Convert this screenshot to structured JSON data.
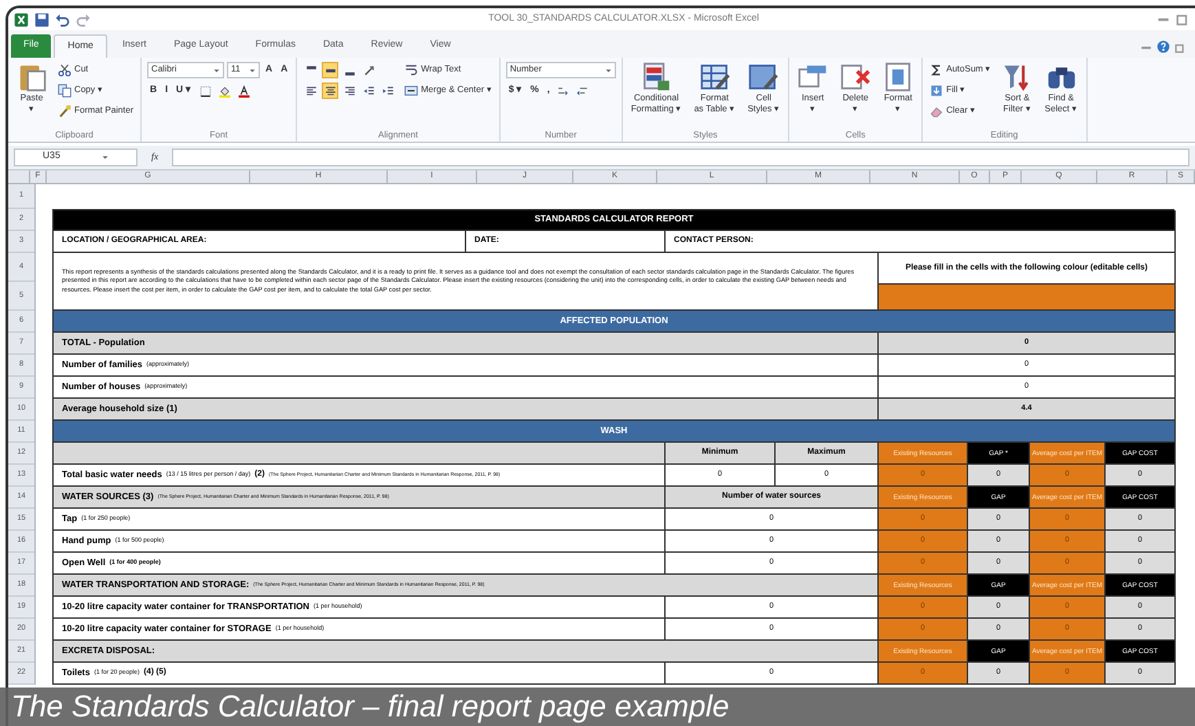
{
  "window": {
    "title": "TOOL 30_STANDARDS CALCULATOR.XLSX - Microsoft Excel"
  },
  "ribbon_tabs": [
    {
      "label": "File",
      "kind": "file",
      "selected": false
    },
    {
      "label": "Home",
      "kind": "tab",
      "selected": true
    },
    {
      "label": "Insert",
      "kind": "tab",
      "selected": false
    },
    {
      "label": "Page Layout",
      "kind": "tab",
      "selected": false
    },
    {
      "label": "Formulas",
      "kind": "tab",
      "selected": false
    },
    {
      "label": "Data",
      "kind": "tab",
      "selected": false
    },
    {
      "label": "Review",
      "kind": "tab",
      "selected": false
    },
    {
      "label": "View",
      "kind": "tab",
      "selected": false
    }
  ],
  "ribbon_groups": [
    {
      "name": "Clipboard",
      "columns": [
        [
          [
            {
              "kind": "large",
              "label": "Paste\n▾"
            }
          ]
        ],
        [
          [
            {
              "kind": "small",
              "label": "Cut"
            }
          ],
          [
            {
              "kind": "small",
              "label": "Copy ▾"
            }
          ],
          [
            {
              "kind": "small",
              "label": "Format Painter"
            }
          ]
        ]
      ]
    },
    {
      "name": "Font",
      "columns": [
        [
          [
            {
              "kind": "combo",
              "label": "Calibri"
            },
            {
              "kind": "combo",
              "label": "11"
            },
            {
              "kind": "glyph",
              "label": "A"
            },
            {
              "kind": "glyph",
              "label": "A"
            }
          ],
          [
            {
              "kind": "glyph",
              "label": "B"
            },
            {
              "kind": "glyph",
              "label": "I"
            },
            {
              "kind": "glyph",
              "label": "U ▾"
            },
            {
              "kind": "icon"
            },
            {
              "kind": "icon"
            },
            {
              "kind": "icon"
            }
          ]
        ]
      ]
    },
    {
      "name": "Alignment",
      "columns": [
        [
          [
            {
              "kind": "icon",
              "selected": false
            },
            {
              "kind": "icon",
              "selected": true
            },
            {
              "kind": "icon",
              "selected": false
            },
            {
              "kind": "icon",
              "selected": false
            }
          ],
          [
            {
              "kind": "icon",
              "selected": false
            },
            {
              "kind": "icon",
              "selected": true
            },
            {
              "kind": "icon",
              "selected": false
            },
            {
              "kind": "icon",
              "selected": false
            },
            {
              "kind": "icon",
              "selected": false
            }
          ]
        ],
        [
          [
            {
              "kind": "small",
              "label": "Wrap Text"
            }
          ],
          [
            {
              "kind": "small",
              "label": "Merge & Center ▾"
            }
          ]
        ]
      ]
    },
    {
      "name": "Number",
      "columns": [
        [
          [
            {
              "kind": "combo",
              "label": "Number"
            }
          ],
          [
            {
              "kind": "glyph",
              "label": "$ ▾"
            },
            {
              "kind": "glyph",
              "label": "%"
            },
            {
              "kind": "glyph",
              "label": ","
            },
            {
              "kind": "icon"
            },
            {
              "kind": "icon"
            }
          ]
        ]
      ]
    },
    {
      "name": "Styles",
      "columns": [
        [
          [
            {
              "kind": "large",
              "label": "Conditional\nFormatting ▾"
            }
          ]
        ],
        [
          [
            {
              "kind": "large",
              "label": "Format\nas Table ▾"
            }
          ]
        ],
        [
          [
            {
              "kind": "large",
              "label": "Cell\nStyles ▾"
            }
          ]
        ]
      ]
    },
    {
      "name": "Cells",
      "columns": [
        [
          [
            {
              "kind": "large",
              "label": "Insert\n▾"
            }
          ]
        ],
        [
          [
            {
              "kind": "large",
              "label": "Delete\n▾"
            }
          ]
        ],
        [
          [
            {
              "kind": "large",
              "label": "Format\n▾"
            }
          ]
        ]
      ]
    },
    {
      "name": "Editing",
      "columns": [
        [
          [
            {
              "kind": "small",
              "label": "AutoSum ▾"
            }
          ],
          [
            {
              "kind": "small",
              "label": "Fill ▾"
            }
          ],
          [
            {
              "kind": "small",
              "label": "Clear ▾"
            }
          ]
        ],
        [
          [
            {
              "kind": "large",
              "label": "Sort &\nFilter ▾"
            }
          ]
        ],
        [
          [
            {
              "kind": "large",
              "label": "Find &\nSelect ▾"
            }
          ]
        ]
      ]
    }
  ],
  "formula_bar": {
    "name_box": "U35",
    "function_button": "fx"
  },
  "columns": [
    "F",
    "G",
    "H",
    "I",
    "J",
    "K",
    "L",
    "M",
    "N",
    "O",
    "P",
    "Q",
    "R",
    "S"
  ],
  "sheet_rows": [
    {
      "kind": "blank",
      "nums": [
        "1"
      ]
    },
    {
      "kind": "title",
      "nums": [
        "2"
      ],
      "text": "STANDARDS CALCULATOR REPORT"
    },
    {
      "kind": "fields",
      "nums": [
        "3"
      ],
      "cells": [
        "LOCATION / GEOGRAPHICAL AREA:",
        "DATE:",
        "CONTACT PERSON:"
      ]
    },
    {
      "kind": "notes",
      "nums": [
        "4",
        "5"
      ],
      "text": "This report represents a synthesis of the standards calculations presented along the Standards Calculator, and it is a ready to print file. It serves as a guidance tool and does not exempt the consultation of each sector standards calculation page in the Standards Calculator. The figures presented in this report are according to the calculations that have to be completed within each sector page of the Standards Calculator. Please insert the existing resources (considering the unit) into the corresponding cells, in order to calculate the existing GAP between needs and resources. Please insert the cost per item, in order to calculate the GAP cost per item, and to calculate the total GAP cost per sector.",
      "legend": "Please fill in the cells with the following colour (editable cells)"
    },
    {
      "kind": "section",
      "nums": [
        "6"
      ],
      "text": "AFFECTED POPULATION"
    },
    {
      "kind": "total",
      "nums": [
        "7"
      ],
      "label": "TOTAL - Population",
      "value": "0",
      "shaded": true
    },
    {
      "kind": "total",
      "nums": [
        "8"
      ],
      "label": "Number of families",
      "note": "(approximately)",
      "value": "0",
      "shaded": false
    },
    {
      "kind": "total",
      "nums": [
        "9"
      ],
      "label": "Number of houses",
      "note": "(approximately)",
      "value": "0",
      "shaded": false
    },
    {
      "kind": "total",
      "nums": [
        "10"
      ],
      "label": "Average household size (1)",
      "value": "4.4",
      "shaded": true
    },
    {
      "kind": "section",
      "nums": [
        "11"
      ],
      "text": "WASH"
    },
    {
      "kind": "heading",
      "nums": [
        "12"
      ],
      "min": "Minimum",
      "max": "Maximum",
      "headers": [
        {
          "text": "Existing Resources",
          "kind": "input"
        },
        {
          "text": "GAP *",
          "kind": "calc"
        },
        {
          "text": "Average cost per ITEM",
          "kind": "input"
        },
        {
          "text": "GAP COST",
          "kind": "calc"
        }
      ]
    },
    {
      "kind": "need",
      "nums": [
        "13"
      ],
      "label": "Total basic water needs",
      "note": "(13 / 15 litres per person / day)",
      "ref": "(2)",
      "cite": "(The Sphere Project, Humanitarian Charter and Minimum Standards in Humanitarian Response, 2011, P. 98)",
      "min": "0",
      "max": "0",
      "values": [
        {
          "text": "0",
          "kind": "input"
        },
        {
          "text": "0",
          "kind": "calc"
        },
        {
          "text": "0",
          "kind": "input"
        },
        {
          "text": "0",
          "kind": "calc"
        }
      ]
    },
    {
      "kind": "group",
      "nums": [
        "14"
      ],
      "label": "WATER SOURCES (3)",
      "cite": "(The Sphere Project, Humanitarian Charter and Minimum Standards in Humanitarian Response, 2011, P. 98)",
      "middle": "Number of water sources",
      "headers": [
        {
          "text": "Existing Resources",
          "kind": "input"
        },
        {
          "text": "GAP",
          "kind": "calc"
        },
        {
          "text": "Average cost per ITEM",
          "kind": "input"
        },
        {
          "text": "GAP COST",
          "kind": "calc"
        }
      ]
    },
    {
      "kind": "item",
      "nums": [
        "15"
      ],
      "label": "Tap",
      "note": "(1 for 250 people)",
      "value": "0",
      "values": [
        {
          "text": "0",
          "kind": "input"
        },
        {
          "text": "0",
          "kind": "calc"
        },
        {
          "text": "0",
          "kind": "input"
        },
        {
          "text": "0",
          "kind": "calc"
        }
      ]
    },
    {
      "kind": "item",
      "nums": [
        "16"
      ],
      "label": "Hand pump",
      "note": "(1 for 500 people)",
      "value": "0",
      "values": [
        {
          "text": "0",
          "kind": "input"
        },
        {
          "text": "0",
          "kind": "calc"
        },
        {
          "text": "0",
          "kind": "input"
        },
        {
          "text": "0",
          "kind": "calc"
        }
      ]
    },
    {
      "kind": "item",
      "nums": [
        "17"
      ],
      "label": "Open Well",
      "note": "**(1 for 400 people)**",
      "value": "0",
      "values": [
        {
          "text": "0",
          "kind": "input"
        },
        {
          "text": "0",
          "kind": "calc"
        },
        {
          "text": "0",
          "kind": "input"
        },
        {
          "text": "0",
          "kind": "calc"
        }
      ]
    },
    {
      "kind": "group",
      "nums": [
        "18"
      ],
      "label": "WATER TRANSPORTATION AND STORAGE:",
      "cite": "(The Sphere Project, Humanitarian Charter and Minimum Standards in Humanitarian Response, 2011, P. 98)",
      "headers": [
        {
          "text": "Existing Resources",
          "kind": "input"
        },
        {
          "text": "GAP",
          "kind": "calc"
        },
        {
          "text": "Average cost per ITEM",
          "kind": "input"
        },
        {
          "text": "GAP COST",
          "kind": "calc"
        }
      ]
    },
    {
      "kind": "item",
      "nums": [
        "19"
      ],
      "label": "10-20 litre capacity water container for TRANSPORTATION",
      "note": "(1 per household)",
      "value": "0",
      "values": [
        {
          "text": "0",
          "kind": "input"
        },
        {
          "text": "0",
          "kind": "calc"
        },
        {
          "text": "0",
          "kind": "input"
        },
        {
          "text": "0",
          "kind": "calc"
        }
      ]
    },
    {
      "kind": "item",
      "nums": [
        "20"
      ],
      "label": "10-20 litre capacity water container for STORAGE",
      "note": "(1 per household)",
      "value": "0",
      "values": [
        {
          "text": "0",
          "kind": "input"
        },
        {
          "text": "0",
          "kind": "calc"
        },
        {
          "text": "0",
          "kind": "input"
        },
        {
          "text": "0",
          "kind": "calc"
        }
      ]
    },
    {
      "kind": "group",
      "nums": [
        "21"
      ],
      "label": "EXCRETA DISPOSAL:",
      "headers": [
        {
          "text": "Existing Resources",
          "kind": "input"
        },
        {
          "text": "GAP",
          "kind": "calc"
        },
        {
          "text": "Average cost per ITEM",
          "kind": "input"
        },
        {
          "text": "GAP COST",
          "kind": "calc"
        }
      ]
    },
    {
      "kind": "item",
      "nums": [
        "22"
      ],
      "label": "Toilets",
      "note": "(1 for 20 people)",
      "ref": "(4) (5)",
      "value": "0",
      "values": [
        {
          "text": "0",
          "kind": "input"
        },
        {
          "text": "0",
          "kind": "calc"
        },
        {
          "text": "0",
          "kind": "input"
        },
        {
          "text": "0",
          "kind": "calc"
        }
      ]
    }
  ],
  "caption": "The Standards Calculator – final report page example"
}
